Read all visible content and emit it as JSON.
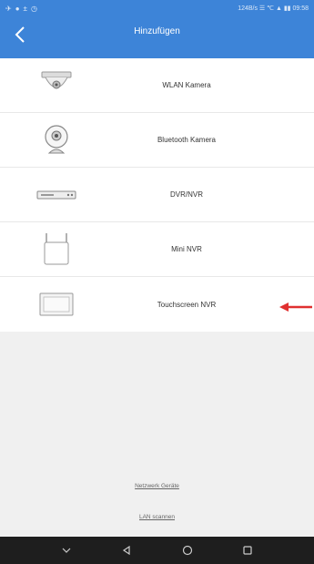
{
  "status_bar": {
    "right_text": "124B/s ☰ ℃ ▲ ▮▮ 09:58"
  },
  "header": {
    "title": "Hinzufügen"
  },
  "items": [
    {
      "label": "WLAN Kamera",
      "icon": "dome-camera-icon"
    },
    {
      "label": "Bluetooth Kamera",
      "icon": "bluetooth-camera-icon"
    },
    {
      "label": "DVR/NVR",
      "icon": "dvr-box-icon"
    },
    {
      "label": "Mini NVR",
      "icon": "mini-nvr-icon"
    },
    {
      "label": "Touchscreen NVR",
      "icon": "touchscreen-nvr-icon"
    }
  ],
  "links": {
    "network_devices": "Netzwerk Geräte",
    "lan_scan": "LAN scannen"
  },
  "colors": {
    "app_bar": "#3d84d8",
    "background": "#f0f0f0",
    "arrow": "#e03030",
    "nav_bar": "#1e1e1e"
  }
}
